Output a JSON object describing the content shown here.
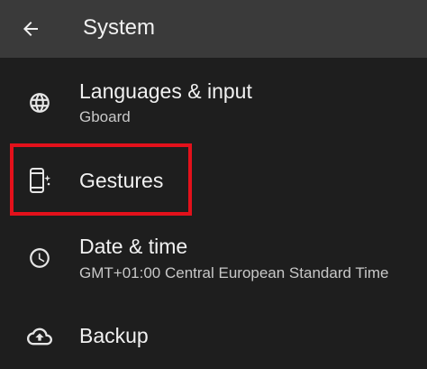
{
  "app_bar": {
    "back_icon": "arrow-left-icon",
    "title": "System"
  },
  "settings_items": [
    {
      "icon": "globe-icon",
      "title": "Languages & input",
      "subtitle": "Gboard"
    },
    {
      "icon": "phone-gesture-icon",
      "title": "Gestures",
      "subtitle": ""
    },
    {
      "icon": "clock-icon",
      "title": "Date & time",
      "subtitle": "GMT+01:00 Central European Standard Time"
    },
    {
      "icon": "cloud-upload-icon",
      "title": "Backup",
      "subtitle": ""
    }
  ],
  "colors": {
    "app_bar_bg": "#3a3a3a",
    "screen_bg": "#1e1e1e",
    "primary_text": "#f1f1f1",
    "secondary_text": "#c8c8c8",
    "highlight": "#e3111b"
  }
}
